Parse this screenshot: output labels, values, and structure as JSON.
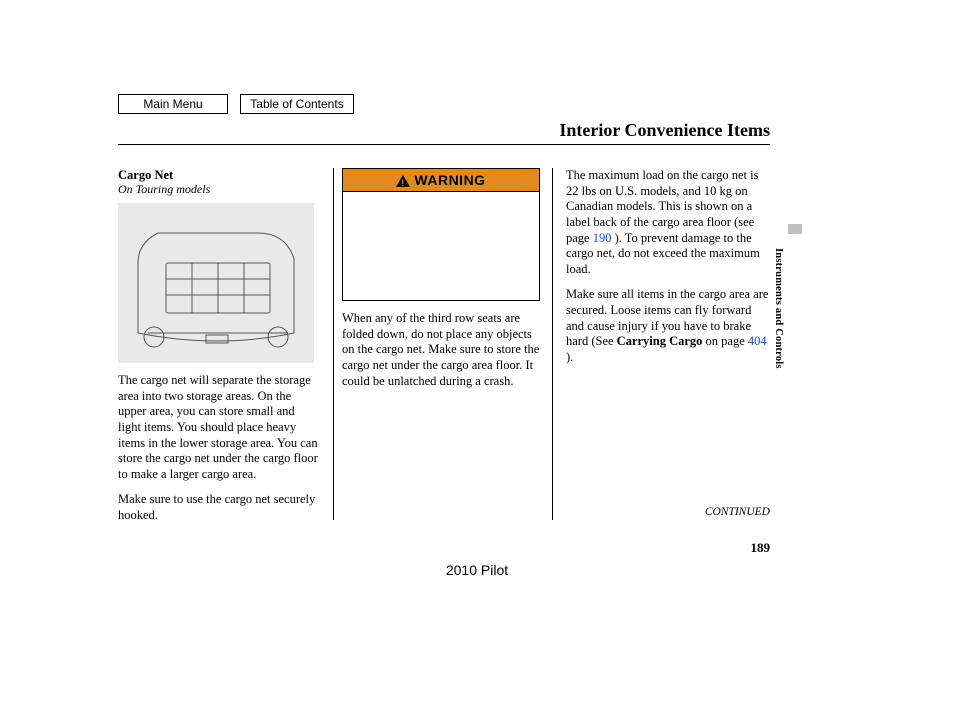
{
  "nav": {
    "main_menu": "Main Menu",
    "toc": "Table of Contents"
  },
  "section_title": "Interior Convenience Items",
  "side_label": "Instruments and Controls",
  "col1": {
    "heading": "Cargo Net",
    "subheading": "On Touring models",
    "p1": "The cargo net will separate the storage area into two storage areas. On the upper area, you can store small and light items. You should place heavy items in the lower storage area. You can store the cargo net under the cargo floor to make a larger cargo area.",
    "p2": "Make sure to use the cargo net securely hooked."
  },
  "col2": {
    "warning_label": "WARNING",
    "p1": "When any of the third row seats are folded down, do not place any objects on the cargo net. Make sure to store the cargo net under the cargo area floor. It could be unlatched during a crash."
  },
  "col3": {
    "p1_a": "The maximum load on the cargo net is 22 lbs on U.S. models, and 10 kg on Canadian models. This is shown on a label back of the cargo area floor (see page ",
    "p1_ref": "190",
    "p1_b": " ). To prevent damage to the cargo net, do not exceed the maximum load.",
    "p2_a": "Make sure all items in the cargo area are secured. Loose items can fly forward and cause injury if you have to brake hard (See ",
    "p2_bold": "Carrying Cargo",
    "p2_b": " on page ",
    "p2_ref": "404",
    "p2_c": " )."
  },
  "continued": "CONTINUED",
  "page_number": "189",
  "footer_model": "2010 Pilot"
}
